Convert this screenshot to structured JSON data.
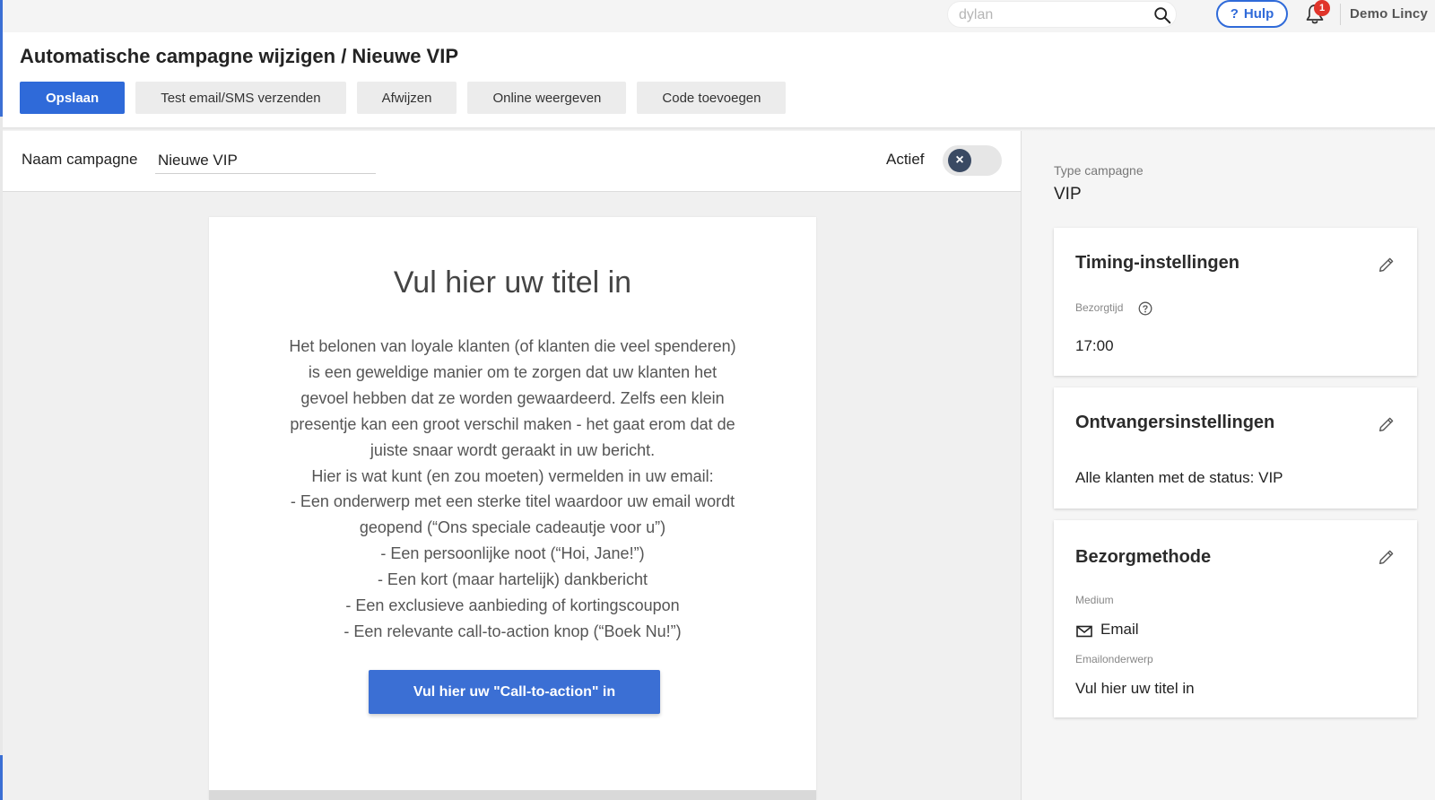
{
  "topbar": {
    "search_placeholder": "dylan",
    "help_label": "Hulp",
    "help_q": "?",
    "notification_count": "1",
    "user_name": "Demo Lincy"
  },
  "header": {
    "title": "Automatische campagne wijzigen / Nieuwe VIP",
    "buttons": {
      "save": "Opslaan",
      "test": "Test email/SMS verzenden",
      "reject": "Afwijzen",
      "online": "Online weergeven",
      "code": "Code toevoegen"
    }
  },
  "campaign": {
    "name_label": "Naam campagne",
    "name_value": "Nieuwe VIP",
    "active_label": "Actief",
    "toggle_symbol": "×"
  },
  "email": {
    "title": "Vul hier uw titel in",
    "body_lines": [
      "Het belonen van loyale klanten (of klanten die veel spenderen)",
      "is een geweldige manier om te zorgen dat uw klanten het",
      "gevoel hebben dat ze worden gewaardeerd. Zelfs een klein",
      "presentje kan een groot verschil maken - het gaat erom dat de",
      "juiste snaar wordt geraakt in uw bericht.",
      "Hier is wat kunt (en zou moeten) vermelden in uw email:",
      "- Een onderwerp met een sterke titel waardoor uw email wordt",
      "geopend (“Ons speciale cadeautje voor u”)",
      "- Een persoonlijke noot (“Hoi, Jane!”)",
      "- Een kort (maar hartelijk) dankbericht",
      "- Een exclusieve aanbieding of kortingscoupon",
      "- Een relevante call-to-action knop (“Boek Nu!”)"
    ],
    "cta_label": "Vul hier uw \"Call-to-action\" in"
  },
  "sidebar": {
    "type_label": "Type campagne",
    "type_value": "VIP",
    "timing": {
      "title": "Timing-instellingen",
      "delivery_time_label": "Bezorgtijd",
      "delivery_time_value": "17:00"
    },
    "recipients": {
      "title": "Ontvangersinstellingen",
      "value": "Alle klanten met de status: VIP"
    },
    "delivery": {
      "title": "Bezorgmethode",
      "medium_label": "Medium",
      "medium_value": "Email",
      "subject_label": "Emailonderwerp",
      "subject_value": "Vul hier uw titel in"
    }
  },
  "colors": {
    "primary": "#2f6ad9",
    "cta": "#3b6fd4",
    "badge": "#e0352b",
    "toggle_knob": "#3a4a63"
  },
  "icons": [
    "search-icon",
    "help-icon",
    "bell-icon",
    "close-icon",
    "pencil-icon",
    "question-circle-icon",
    "mail-icon"
  ]
}
